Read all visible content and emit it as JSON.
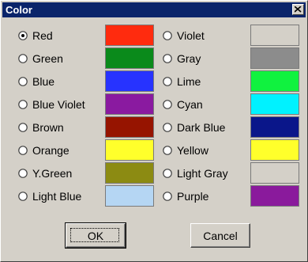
{
  "window": {
    "title": "Color",
    "close_glyph": "close-icon"
  },
  "colors": {
    "left": [
      {
        "label": "Red",
        "swatch": "#ff2b0e",
        "selected": true
      },
      {
        "label": "Green",
        "swatch": "#0a8a1b",
        "selected": false
      },
      {
        "label": "Blue",
        "swatch": "#2733ff",
        "selected": false
      },
      {
        "label": "Blue Violet",
        "swatch": "#8a1aa0",
        "selected": false
      },
      {
        "label": "Brown",
        "swatch": "#961400",
        "selected": false
      },
      {
        "label": "Orange",
        "swatch": "#ffff2b",
        "selected": false
      },
      {
        "label": "Y.Green",
        "swatch": "#8c8b12",
        "selected": false
      },
      {
        "label": "Light Blue",
        "swatch": "#b5d6f3",
        "selected": false
      }
    ],
    "right": [
      {
        "label": "Violet",
        "swatch": "#d4d0c8",
        "selected": false
      },
      {
        "label": "Gray",
        "swatch": "#8c8c8c",
        "selected": false
      },
      {
        "label": "Lime",
        "swatch": "#10f23f",
        "selected": false
      },
      {
        "label": "Cyan",
        "swatch": "#00f2ff",
        "selected": false
      },
      {
        "label": "Dark Blue",
        "swatch": "#0a168a",
        "selected": false
      },
      {
        "label": "Yellow",
        "swatch": "#ffff2b",
        "selected": false
      },
      {
        "label": "Light Gray",
        "swatch": "#d4d0c8",
        "selected": false
      },
      {
        "label": "Purple",
        "swatch": "#8a1a9c",
        "selected": false
      }
    ]
  },
  "buttons": {
    "ok": "OK",
    "cancel": "Cancel"
  }
}
